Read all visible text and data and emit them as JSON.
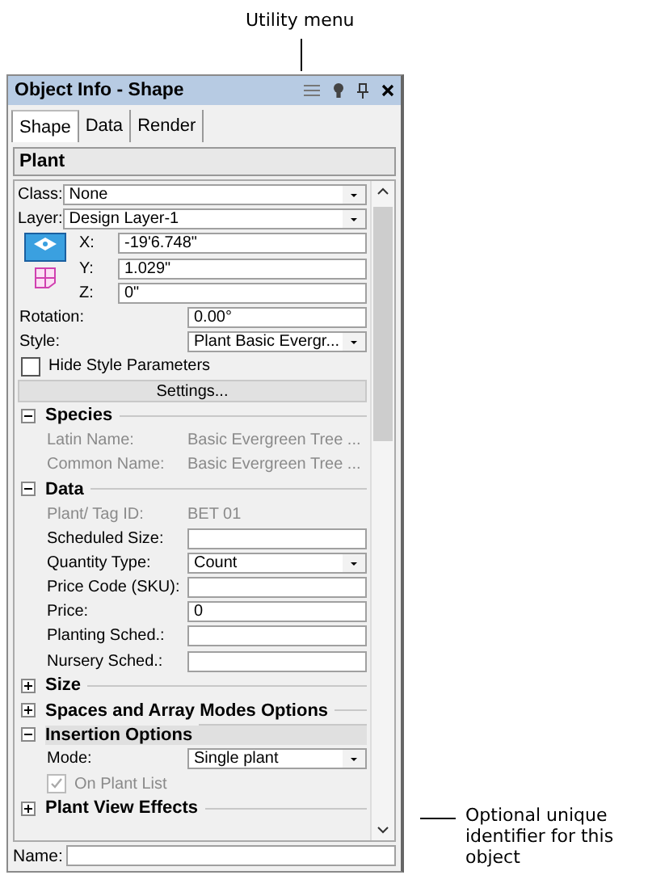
{
  "callouts": {
    "top": "Utility menu",
    "right": "Optional unique identifier for this object"
  },
  "panel": {
    "title": "Object Info - Shape",
    "tabs": [
      {
        "label": "Shape",
        "selected": true
      },
      {
        "label": "Data",
        "selected": false
      },
      {
        "label": "Render",
        "selected": false
      }
    ],
    "header": "Plant",
    "class": {
      "label": "Class:",
      "value": "None"
    },
    "layer": {
      "label": "Layer:",
      "value": "Design Layer-1"
    },
    "coords": [
      {
        "label": "X:",
        "value": "-19'6.748\""
      },
      {
        "label": "Y:",
        "value": "1.029\""
      },
      {
        "label": "Z:",
        "value": "0\""
      }
    ],
    "rows": [
      {
        "kind": "field",
        "label": "Rotation:",
        "value": "0.00°"
      },
      {
        "kind": "dropdown",
        "label": "Style:",
        "value": "Plant Basic Evergr..."
      },
      {
        "kind": "checkbox",
        "label": "Hide Style Parameters",
        "checked": false,
        "disabled": false
      },
      {
        "kind": "button",
        "label": "Settings..."
      },
      {
        "kind": "section",
        "label": "Species",
        "expanded": true,
        "selected": false
      },
      {
        "kind": "readonly",
        "label": "Latin Name:",
        "value": "Basic Evergreen Tree ..."
      },
      {
        "kind": "readonly",
        "label": "Common Name:",
        "value": "Basic Evergreen Tree ..."
      },
      {
        "kind": "section",
        "label": "Data",
        "expanded": true,
        "selected": false
      },
      {
        "kind": "readonly",
        "label": "Plant/ Tag ID:",
        "value": "BET 01"
      },
      {
        "kind": "field",
        "label": "Scheduled Size:"
      },
      {
        "kind": "dropdown",
        "label": "Quantity Type:",
        "value": "Count"
      },
      {
        "kind": "field",
        "label": "Price Code (SKU):"
      },
      {
        "kind": "field",
        "label": "Price:",
        "value": "0"
      },
      {
        "kind": "field",
        "label": "Planting Sched.:"
      },
      {
        "kind": "field",
        "label": "Nursery Sched.:"
      },
      {
        "kind": "section",
        "label": "Size",
        "expanded": false,
        "selected": false
      },
      {
        "kind": "section",
        "label": "Spaces and Array Modes Options",
        "expanded": false,
        "selected": false
      },
      {
        "kind": "section",
        "label": "Insertion Options",
        "expanded": true,
        "selected": true
      },
      {
        "kind": "dropdown",
        "label": "Mode:",
        "value": "Single plant"
      },
      {
        "kind": "checkbox",
        "label": "On Plant List",
        "checked": true,
        "disabled": true
      },
      {
        "kind": "section",
        "label": "Plant View Effects",
        "expanded": false,
        "selected": false
      }
    ],
    "name_field": {
      "label": "Name:"
    }
  }
}
